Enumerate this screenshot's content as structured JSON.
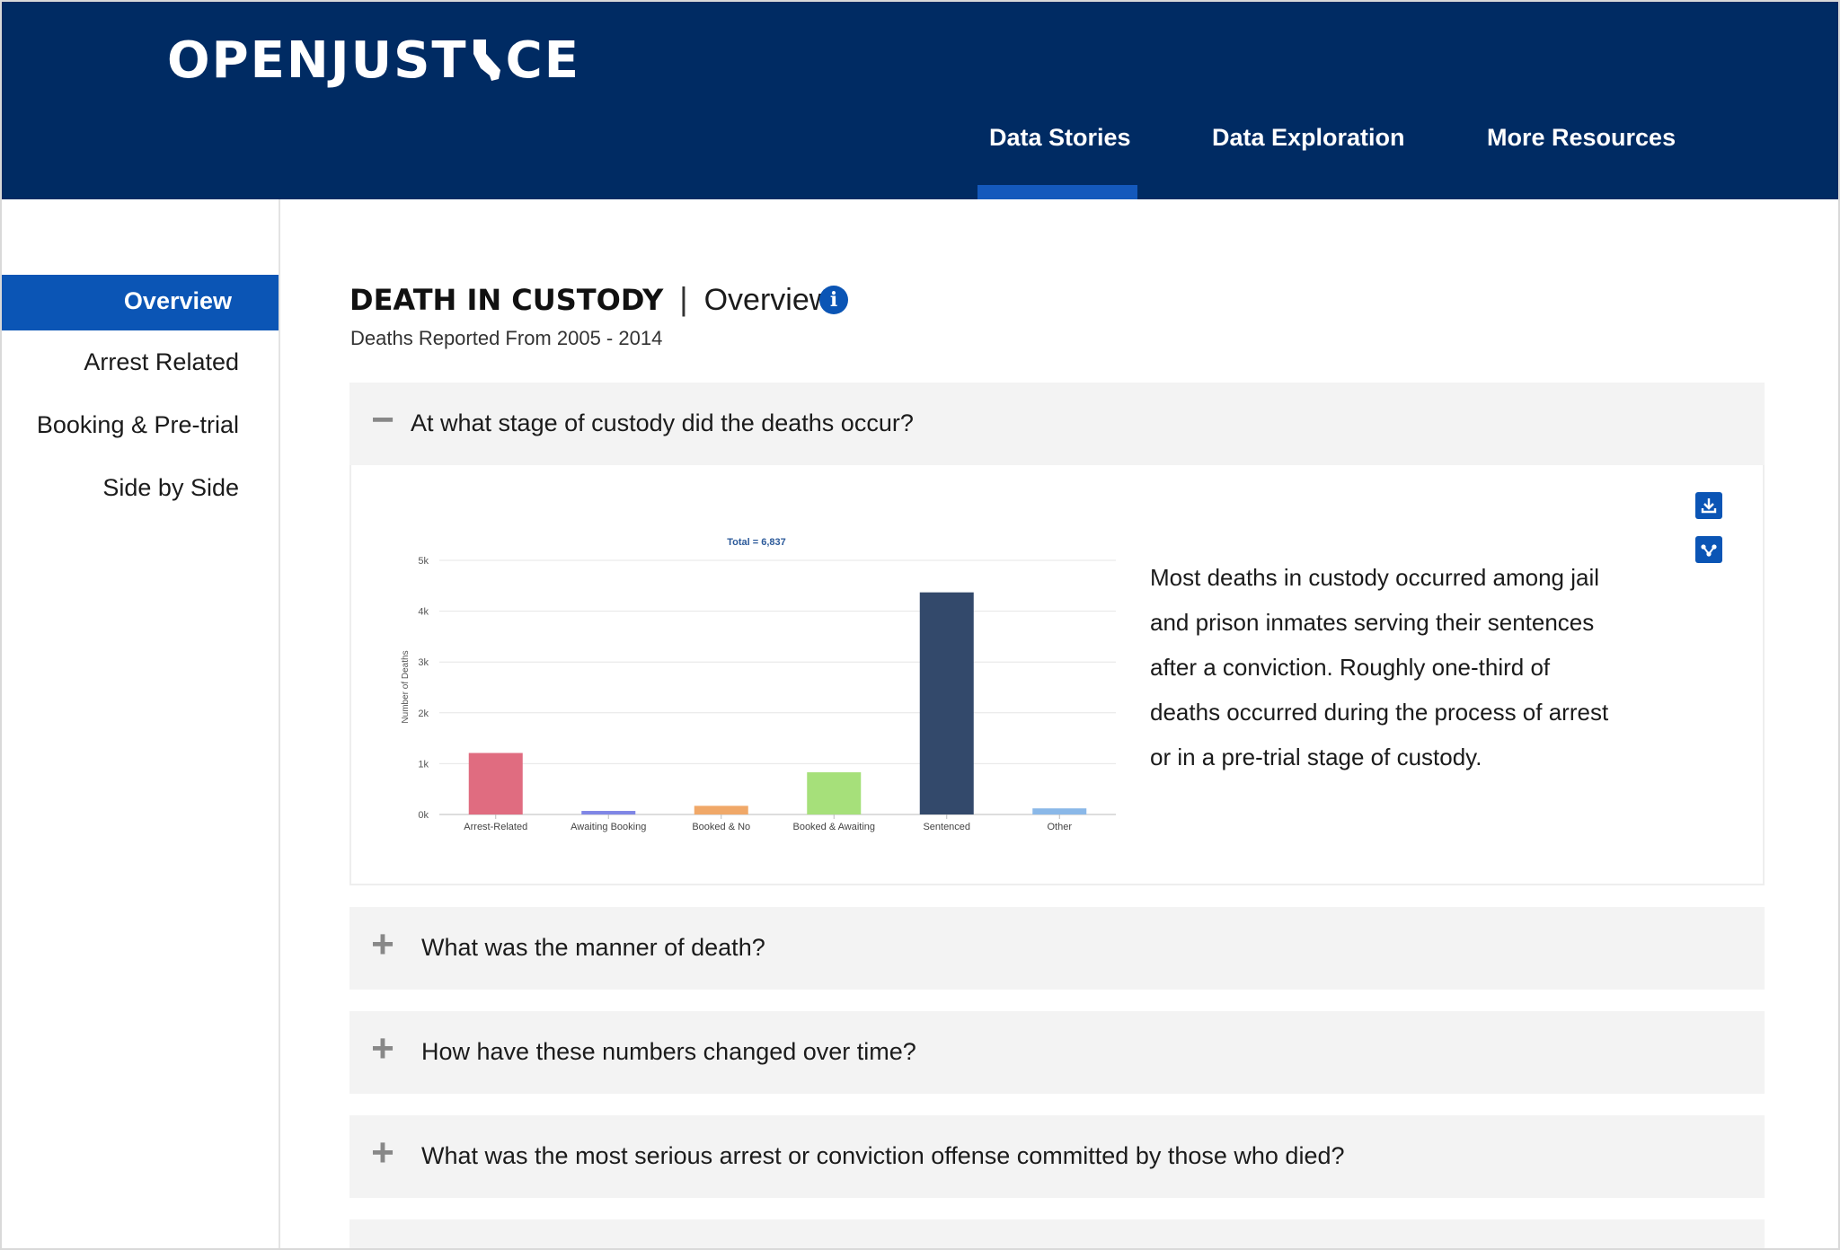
{
  "header": {
    "logo_text": "OPENJUSTICE",
    "nav": [
      {
        "label": "Data Stories",
        "active": true
      },
      {
        "label": "Data Exploration",
        "active": false
      },
      {
        "label": "More Resources",
        "active": false
      }
    ]
  },
  "sidebar": {
    "items": [
      {
        "label": "Overview",
        "active": true
      },
      {
        "label": "Arrest Related",
        "active": false
      },
      {
        "label": "Booking & Pre-trial",
        "active": false
      },
      {
        "label": "Side by Side",
        "active": false
      }
    ]
  },
  "page": {
    "title": "DEATH IN CUSTODY",
    "separator": "|",
    "section": "Overview",
    "subtitle": "Deaths Reported From 2005 - 2014",
    "info_icon": "i"
  },
  "accordion": [
    {
      "question": "At what stage of custody did the deaths occur?",
      "expanded": true,
      "sign": "−"
    },
    {
      "question": "What was the manner of death?",
      "expanded": false,
      "sign": "+"
    },
    {
      "question": "How have these numbers changed over time?",
      "expanded": false,
      "sign": "+"
    },
    {
      "question": "What was the most serious arrest or conviction offense committed by those who died?",
      "expanded": false,
      "sign": "+"
    }
  ],
  "panel": {
    "description": "Most deaths in custody occurred among jail and prison inmates serving their sentences after a conviction. Roughly one-third of deaths occurred during the process of arrest or in a pre-trial stage of custody.",
    "tools": [
      "download-icon",
      "share-icon"
    ]
  },
  "chart_data": {
    "type": "bar",
    "title": "Total = 6,837",
    "ylabel": "Number of Deaths",
    "xlabel": "",
    "ylim": [
      0,
      5000
    ],
    "yticks": [
      "0k",
      "1k",
      "2k",
      "3k",
      "4k",
      "5k"
    ],
    "ytick_values": [
      0,
      1000,
      2000,
      3000,
      4000,
      5000
    ],
    "grid": true,
    "categories": [
      "Arrest-Related",
      "Awaiting Booking",
      "Booked & No",
      "Booked & Awaiting",
      "Sentenced",
      "Other"
    ],
    "values": [
      1210,
      70,
      170,
      830,
      4370,
      120
    ],
    "colors": [
      "#e06c80",
      "#7f86e6",
      "#f0a868",
      "#a6e07a",
      "#33496b",
      "#8ab8e8"
    ]
  },
  "colors": {
    "header_bg": "#002b63",
    "accent": "#0b55b5",
    "accordion_bg": "#f3f3f3"
  }
}
